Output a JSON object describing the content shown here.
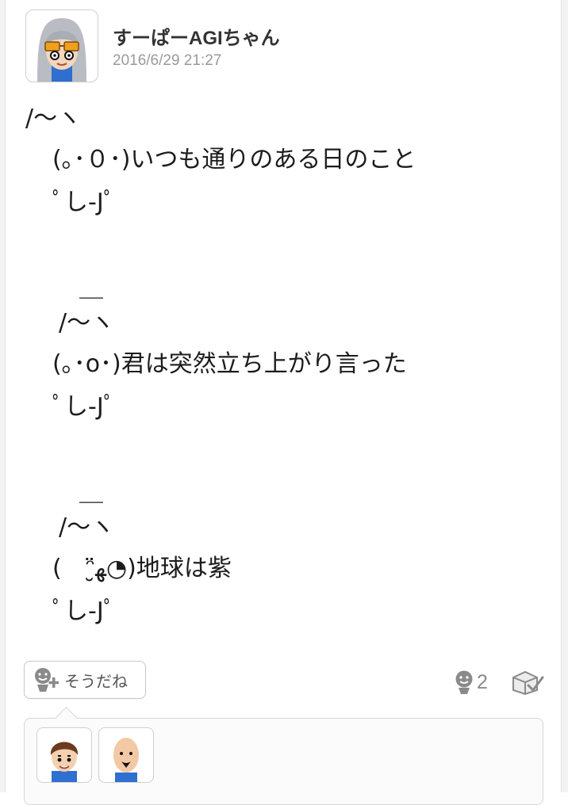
{
  "post": {
    "user_name": "すーぱーAGIちゃん",
    "timestamp": "2016/6/29 21:27",
    "lines": [
      "/〜ヽ",
      "(｡･０･)いつも通りのある日のこと",
      "ﾟし-Jﾟ",
      "＿",
      "/〜ヽ",
      "(｡･o･)君は突然立ち上がり言った",
      "ﾟし-Jﾟ",
      "＿",
      "/〜ヽ",
      "(　ᵔ̮ﻬ̈◔)地球は紫",
      "ﾟし-Jﾟ"
    ]
  },
  "actions": {
    "yeah_label": "そうだね",
    "yeah_count": "2"
  },
  "icons": {
    "yeah_add": "yeah-add-icon",
    "yeah_count": "yeah-face-icon",
    "spoiler_tag": "checkbox-tag-icon"
  },
  "colors": {
    "text": "#1c1c1c",
    "timestamp": "#9a9a9a",
    "icon_gray": "#8a8a8a",
    "border": "#cfcfcf"
  }
}
